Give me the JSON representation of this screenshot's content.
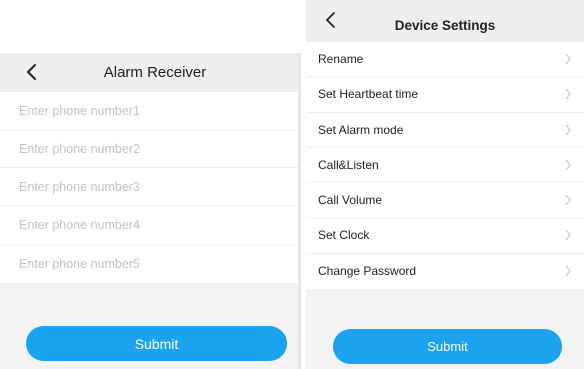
{
  "alarm_receiver": {
    "title": "Alarm Receiver",
    "phone_fields": [
      {
        "placeholder": "Enter phone number1",
        "value": ""
      },
      {
        "placeholder": "Enter phone number2",
        "value": ""
      },
      {
        "placeholder": "Enter phone number3",
        "value": ""
      },
      {
        "placeholder": "Enter phone number4",
        "value": ""
      },
      {
        "placeholder": "Enter phone number5",
        "value": ""
      }
    ],
    "submit_label": "Submit"
  },
  "device_settings": {
    "title": "Device Settings",
    "items": [
      {
        "label": "Rename"
      },
      {
        "label": "Set Heartbeat time"
      },
      {
        "label": "Set Alarm mode"
      },
      {
        "label": "Call&Listen"
      },
      {
        "label": "Call Volume"
      },
      {
        "label": "Set Clock"
      },
      {
        "label": "Change Password"
      }
    ],
    "submit_label": "Submit"
  },
  "icons": {
    "back": "chevron-left-icon",
    "row_arrow": "chevron-right-icon"
  },
  "colors": {
    "accent": "#1ba3f0",
    "screen_background": "#f3f3f3",
    "header_background": "#eeeeee",
    "placeholder_text": "#c2c2c2",
    "chevron": "#c8c8c8"
  }
}
